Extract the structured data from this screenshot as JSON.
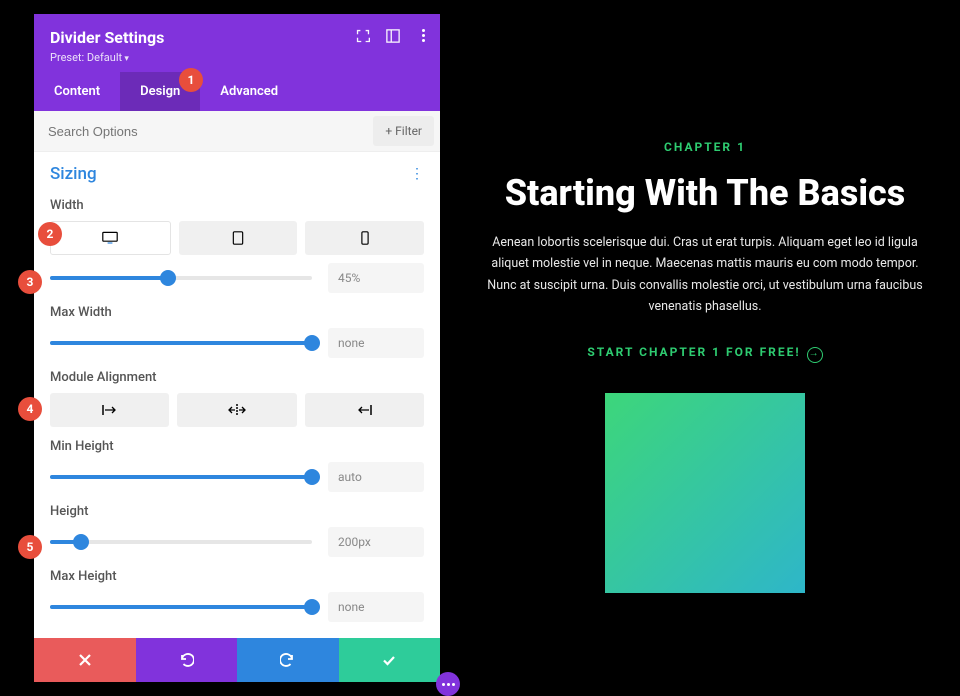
{
  "preview": {
    "eyebrow": "CHAPTER 1",
    "title": "Starting With The Basics",
    "body": "Aenean lobortis scelerisque dui. Cras ut erat turpis. Aliquam eget leo id ligula aliquet molestie vel in neque. Maecenas mattis mauris eu com modo tempor. Nunc at suscipit urna. Duis convallis molestie orci, ut vestibulum urna faucibus venenatis phasellus.",
    "cta": "START CHAPTER 1 FOR FREE!"
  },
  "panel": {
    "title": "Divider Settings",
    "preset": "Preset: Default",
    "tabs": {
      "content": "Content",
      "design": "Design",
      "advanced": "Advanced"
    },
    "search_placeholder": "Search Options",
    "filter": "Filter",
    "section": "Sizing",
    "fields": {
      "width": {
        "label": "Width",
        "value": "45%",
        "pct": 45
      },
      "max_width": {
        "label": "Max Width",
        "value": "none",
        "pct": 100
      },
      "alignment": {
        "label": "Module Alignment"
      },
      "min_height": {
        "label": "Min Height",
        "value": "auto",
        "pct": 100
      },
      "height": {
        "label": "Height",
        "value": "200px",
        "pct": 12
      },
      "max_height": {
        "label": "Max Height",
        "value": "none",
        "pct": 100
      }
    }
  },
  "badges": {
    "b1": "1",
    "b2": "2",
    "b3": "3",
    "b4": "4",
    "b5": "5"
  }
}
